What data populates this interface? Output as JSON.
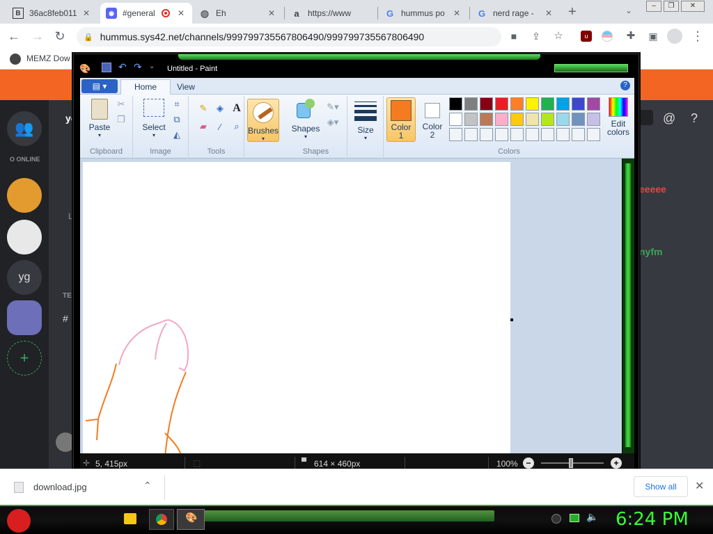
{
  "browser": {
    "tabs": [
      {
        "title": "36ac8feb011",
        "icon": "b-favicon-icon"
      },
      {
        "title": "#general",
        "icon": "discord-favicon-icon",
        "active": true
      },
      {
        "title": "Eh",
        "icon": "globe-icon"
      },
      {
        "title": "https://www",
        "icon": "amazon-favicon-icon"
      },
      {
        "title": "hummus po",
        "icon": "google-favicon-icon"
      },
      {
        "title": "nerd rage - ",
        "icon": "google-favicon-icon"
      }
    ],
    "url": "hummus.sys42.net/channels/999799735567806490/999799735567806490",
    "bookmark": "MEMZ Dow"
  },
  "discord": {
    "online_label": "O ONLINE",
    "server_initials": "yg",
    "header_fragment": "yo",
    "messages": [
      {
        "text": "eeeee",
        "color": "#ed4245"
      },
      {
        "text": "nyfm",
        "color": "#3ba55c"
      }
    ],
    "channel_fragments": [
      "L",
      "TE",
      "# "
    ]
  },
  "paint": {
    "title": "Untitled - Paint",
    "tabs": [
      "Home",
      "View"
    ],
    "groups": {
      "clipboard": {
        "label": "Clipboard",
        "paste": "Paste"
      },
      "image": {
        "label": "Image",
        "select": "Select"
      },
      "tools": {
        "label": "Tools"
      },
      "brushes": {
        "label": "Brushes"
      },
      "shapes": {
        "label": "Shapes",
        "button": "Shapes"
      },
      "size": {
        "label": "Size"
      },
      "colors": {
        "label": "Colors",
        "color1": "Color\n1",
        "color2": "Color\n2",
        "edit": "Edit\ncolors"
      }
    },
    "color1": "#f47b20",
    "color2": "#ffffff",
    "palette_row1": [
      "#000000",
      "#7f7f7f",
      "#880015",
      "#ed1c24",
      "#ff7f27",
      "#fff200",
      "#22b14c",
      "#00a2e8",
      "#3f48cc",
      "#a349a4"
    ],
    "palette_row2": [
      "#ffffff",
      "#c3c3c3",
      "#b97a57",
      "#ffaec9",
      "#ffc90e",
      "#efe4b0",
      "#b5e61d",
      "#99d9ea",
      "#7092be",
      "#c8bfe7"
    ],
    "status": {
      "cursor": "5, 415px",
      "dimensions": "614 × 460px",
      "zoom": "100%"
    }
  },
  "downloads": {
    "filename": "download.jpg",
    "show_all": "Show all"
  },
  "taskbar": {
    "clock": "6:24 PM"
  }
}
